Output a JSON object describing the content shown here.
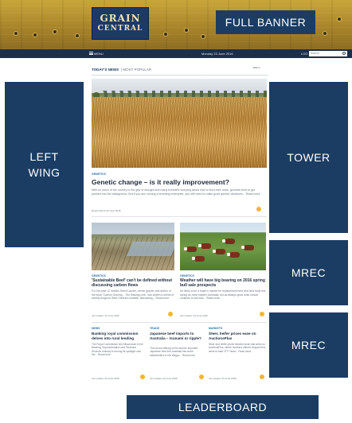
{
  "banner": {
    "logo_line1": "GRAIN",
    "logo_line2": "CENTRAL",
    "label": "FULL BANNER"
  },
  "nav": {
    "menu": "MENU",
    "date": "Monday 23 June 2016",
    "login": "LOG",
    "search_placeholder": "Search"
  },
  "section": {
    "todays_news": "TODAY'S NEWS",
    "most_popular": "| MOST POPULAR",
    "weather": "Wilson"
  },
  "ads": {
    "left": [
      "LEFT",
      "WING"
    ],
    "tower": "TOWER",
    "mrec1": "MREC",
    "mrec2": "MREC",
    "leaderboard": "LEADERBOARD"
  },
  "hero": {
    "kicker": "GENETICS",
    "title": "Genetic change – is it really improvement?",
    "body": "With so much of the country in the grip of drought and many breeders worrying about how to feed their cows, genetics tend to get pushed into the background. But if you are running a breeding enterprise, you still need to make good genetic decisions... Read more",
    "byline": "Report About 23 June 2016"
  },
  "mid": [
    {
      "kicker": "GENETICS",
      "title": "'Sustainable Beef' can't be defined without discussing carbon flows",
      "body": "For the past 12 months Steve Lauder, former grazier and author of the book 'Carbon Grazing – The Missing Link', has written a series of weekly blogs for Beef Central's website, discussing... Read more",
      "byline": "Jon Lauder, 23 June 2016"
    },
    {
      "kicker": "GENETICS",
      "title": "Weather will have big bearing on 2016 spring bull sale prospects",
      "body": "It's likely to be a buyer's market for replacement herd and stud bulls this spring as most eastern Australia, but as always good bulls should continue to sell well... Read more",
      "byline": "Jon Lauder, 23 June 2016"
    }
  ],
  "small": [
    {
      "kicker": "NEWS",
      "title": "Banking royal commission delves into rural lending",
      "body": "The Royal Commission into Misconduct in the Banking, Superannuation and Financial Services Industry is turning its spotlight onto the... Read more",
      "byline": "Jon Lauder, 23 June 2016"
    },
    {
      "kicker": "TRADE",
      "title": "Japanese beef imports to Australia – tsunami or ripple?",
      "body": "The record offering of the last ten imported Japanese beef into Australia has some stakeholders in the Wagyu... Read more",
      "byline": "Jon Lauder, 23 June 2016"
    },
    {
      "kicker": "MARKETS",
      "title": "Steer, heifer prices ease on AuctionsPlus",
      "body": "Steer and heifer prices trended down last week on AuctionsPlus, where numbers offered dropped this week to total 7377 head... Read more",
      "byline": "Jon Lauder, 23 June 2016"
    }
  ]
}
